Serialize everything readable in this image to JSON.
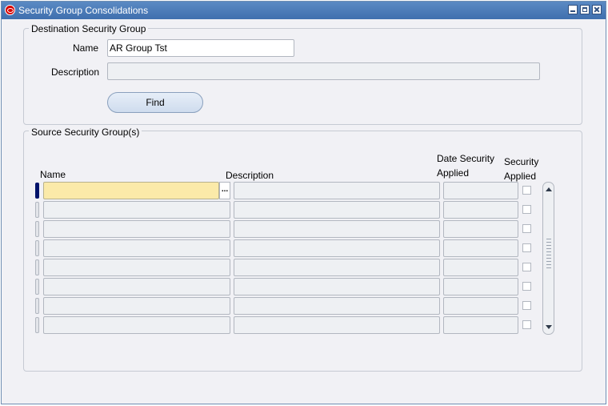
{
  "window": {
    "title": "Security Group Consolidations"
  },
  "destination_group": {
    "title": "Destination Security Group",
    "name_label": "Name",
    "name_value": "AR Group Tst",
    "description_label": "Description",
    "description_value": "",
    "find_label": "Find"
  },
  "source_group": {
    "title": "Source Security Group(s)",
    "columns": {
      "name": "Name",
      "description": "Description",
      "date_security_applied_line1": "Date Security",
      "date_security_applied_line2": "Applied",
      "security_applied_line1": "Security",
      "security_applied_line2": "Applied"
    },
    "lov_button_label": "...",
    "rows": [
      {
        "name": "",
        "description": "",
        "date_security_applied": "",
        "security_applied": false,
        "active": true
      },
      {
        "name": "",
        "description": "",
        "date_security_applied": "",
        "security_applied": false,
        "active": false
      },
      {
        "name": "",
        "description": "",
        "date_security_applied": "",
        "security_applied": false,
        "active": false
      },
      {
        "name": "",
        "description": "",
        "date_security_applied": "",
        "security_applied": false,
        "active": false
      },
      {
        "name": "",
        "description": "",
        "date_security_applied": "",
        "security_applied": false,
        "active": false
      },
      {
        "name": "",
        "description": "",
        "date_security_applied": "",
        "security_applied": false,
        "active": false
      },
      {
        "name": "",
        "description": "",
        "date_security_applied": "",
        "security_applied": false,
        "active": false
      },
      {
        "name": "",
        "description": "",
        "date_security_applied": "",
        "security_applied": false,
        "active": false
      }
    ]
  },
  "colors": {
    "titlebar": "#3f6fae",
    "window_bg": "#f1f1f5",
    "active_field": "#fbeaa9",
    "row_indicator_active": "#00136a"
  },
  "icons": {
    "app": "oracle-icon",
    "minimize": "minimize-icon",
    "maximize": "maximize-icon",
    "close": "close-icon"
  }
}
